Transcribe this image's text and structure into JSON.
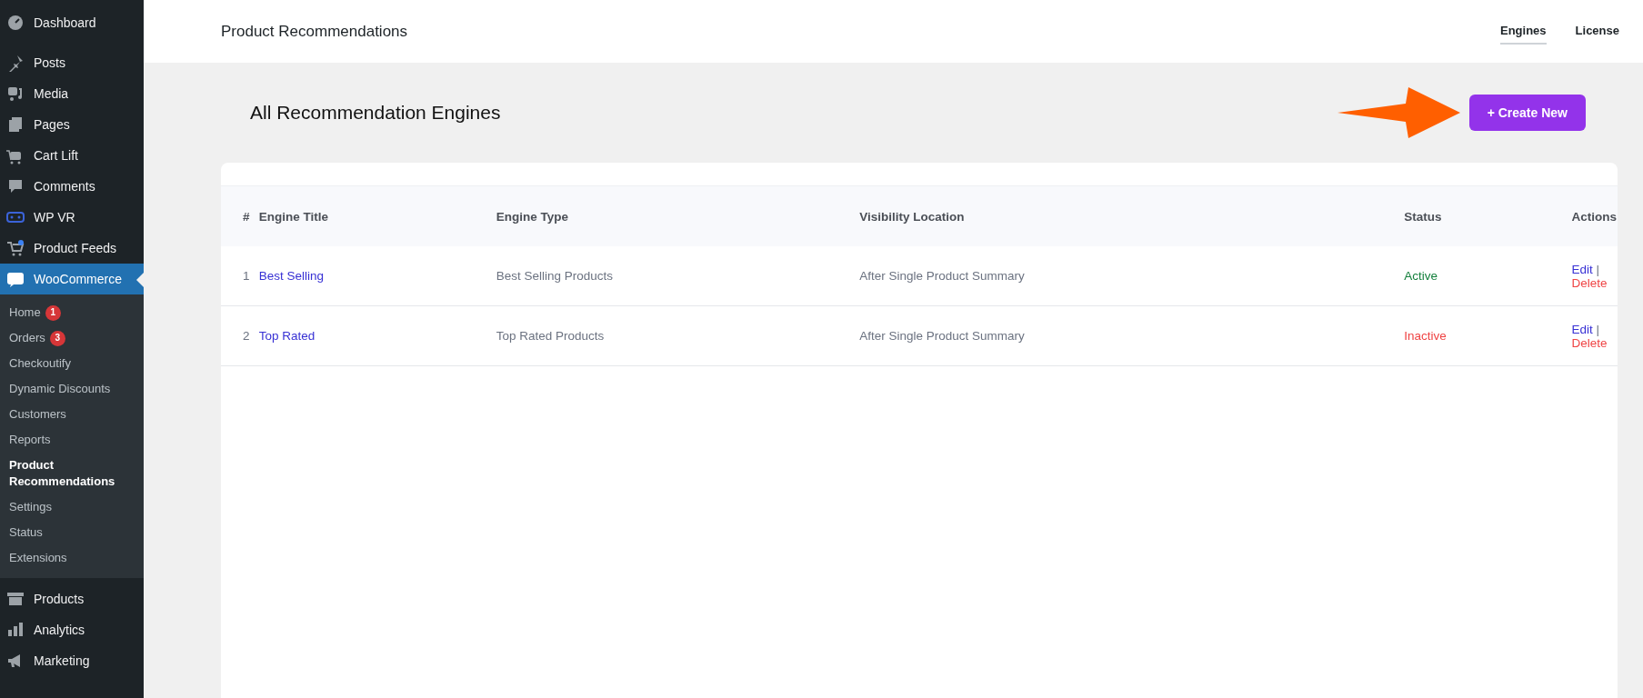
{
  "sidebar": {
    "items": [
      {
        "label": "Dashboard",
        "selected": false
      },
      {
        "label": "Posts",
        "selected": false
      },
      {
        "label": "Media",
        "selected": false
      },
      {
        "label": "Pages",
        "selected": false
      },
      {
        "label": "Cart Lift",
        "selected": false
      },
      {
        "label": "Comments",
        "selected": false
      },
      {
        "label": "WP VR",
        "selected": false
      },
      {
        "label": "Product Feeds",
        "selected": false
      },
      {
        "label": "WooCommerce",
        "selected": true,
        "children": [
          {
            "label": "Home",
            "badge": "1",
            "selected": false
          },
          {
            "label": "Orders",
            "badge": "3",
            "selected": false
          },
          {
            "label": "Checkoutify",
            "selected": false
          },
          {
            "label": "Dynamic Discounts",
            "selected": false
          },
          {
            "label": "Customers",
            "selected": false
          },
          {
            "label": "Reports",
            "selected": false
          },
          {
            "label": "Product Recommendations",
            "selected": true
          },
          {
            "label": "Settings",
            "selected": false
          },
          {
            "label": "Status",
            "selected": false
          },
          {
            "label": "Extensions",
            "selected": false
          }
        ]
      },
      {
        "label": "Products",
        "selected": false
      },
      {
        "label": "Analytics",
        "selected": false
      },
      {
        "label": "Marketing",
        "selected": false
      }
    ]
  },
  "header": {
    "title": "Product Recommendations",
    "tabs": [
      {
        "label": "Engines",
        "selected": true
      },
      {
        "label": "License",
        "selected": false
      }
    ]
  },
  "page": {
    "heading": "All Recommendation Engines",
    "create_button": "+ Create New"
  },
  "table": {
    "columns": [
      "#",
      "Engine Title",
      "Engine Type",
      "Visibility Location",
      "Status",
      "Actions"
    ],
    "rows": [
      {
        "number": "1",
        "title": "Best Selling",
        "type": "Best Selling Products",
        "location": "After Single Product Summary",
        "status": "Active",
        "active": true,
        "edit": "Edit",
        "separator": "|",
        "delete": "Delete"
      },
      {
        "number": "2",
        "title": "Top Rated",
        "type": "Top Rated Products",
        "location": "After Single Product Summary",
        "status": "Inactive",
        "active": false,
        "edit": "Edit",
        "separator": "|",
        "delete": "Delete"
      }
    ]
  }
}
